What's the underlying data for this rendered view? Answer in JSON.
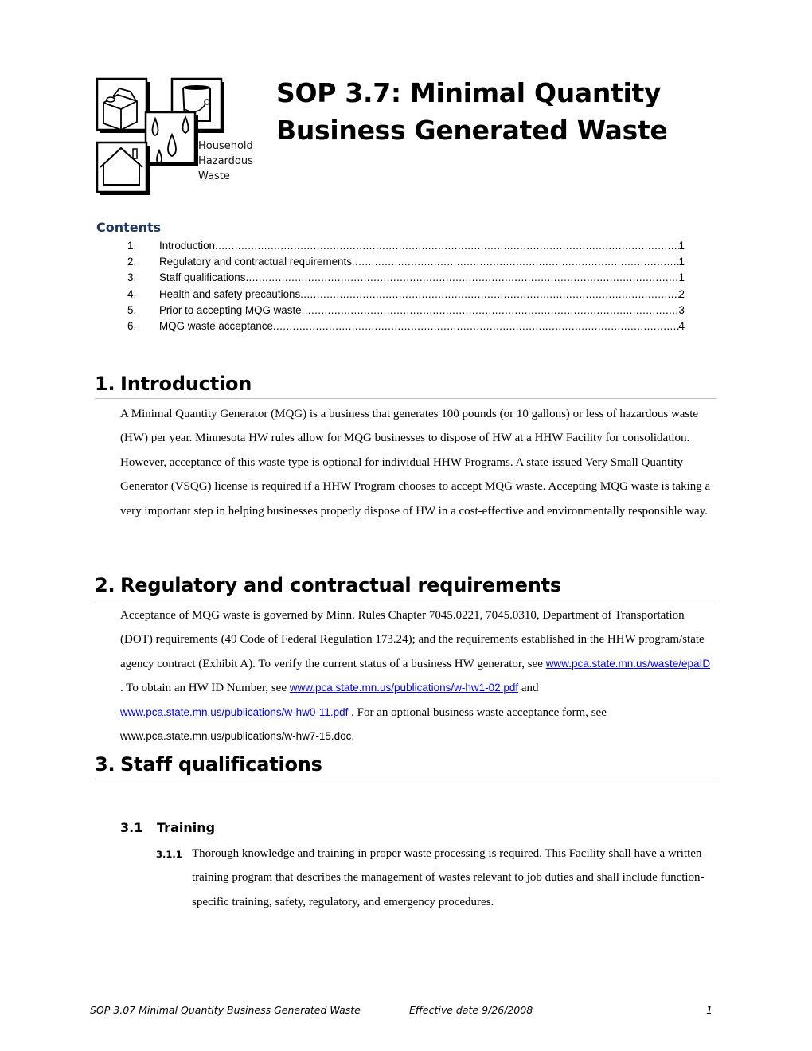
{
  "logo": {
    "caption_lines": [
      "Household",
      "Hazardous",
      "Waste"
    ]
  },
  "title": {
    "line1": "SOP 3.7: Minimal Quantity",
    "line2": "Business Generated Waste"
  },
  "contents": {
    "heading": "Contents",
    "items": [
      {
        "num": "1.",
        "label": "Introduction",
        "page": "1"
      },
      {
        "num": "2.",
        "label": "Regulatory and contractual requirements",
        "page": "1"
      },
      {
        "num": "3.",
        "label": "Staff qualifications",
        "page": "1"
      },
      {
        "num": "4.",
        "label": "Health and safety precautions",
        "page": "2"
      },
      {
        "num": "5.",
        "label": "Prior to accepting MQG waste",
        "page": "3"
      },
      {
        "num": "6.",
        "label": "MQG waste acceptance",
        "page": "4"
      }
    ]
  },
  "sections": {
    "intro": {
      "num": "1.",
      "title": "Introduction",
      "body": "A Minimal Quantity Generator (MQG) is a business that generates 100 pounds (or 10 gallons) or less of hazardous waste (HW) per year. Minnesota HW rules allow for MQG businesses to dispose of HW at a HHW Facility for consolidation. However, acceptance of this waste type is optional for individual HHW Programs. A state-issued Very Small Quantity Generator (VSQG) license is required if a HHW Program chooses to accept MQG waste. Accepting MQG waste is taking a very important step in helping businesses properly dispose of HW in a cost-effective and environmentally responsible way."
    },
    "regulatory": {
      "num": "2.",
      "title": "Regulatory and contractual requirements",
      "text1": "Acceptance of MQG waste is governed by Minn. Rules Chapter 7045.0221, 7045.0310, Department of Transportation (DOT) requirements (49 Code of Federal Regulation 173.24); and the requirements established in the HHW program/state agency contract (Exhibit A). To verify the current status of a business HW generator, see ",
      "link1": "www.pca.state.mn.us/waste/epaID",
      "text2": " . To obtain an HW ID Number, see ",
      "link2": "www.pca.state.mn.us/publications/w-hw1-02.pdf",
      "text3": " and ",
      "link3": "www.pca.state.mn.us/publications/w-hw0-11.pdf",
      "text4": " . For an optional business waste acceptance form, see ",
      "url_plain": "www.pca.state.mn.us/publications/w-hw7-15.doc",
      "text5": "."
    },
    "staff": {
      "num": "3.",
      "title": "Staff qualifications",
      "sub": {
        "num": "3.1",
        "title": "Training",
        "item_num": "3.1.1",
        "item_text": "Thorough knowledge and training in proper waste processing is required. This Facility shall have a written training program that describes the management of wastes relevant to job duties and shall include function-specific training, safety, regulatory, and emergency procedures."
      }
    }
  },
  "footer": {
    "doc_title": "SOP 3.07 Minimal Quantity Business Generated Waste",
    "effective": "Effective date 9/26/2008",
    "page": "1"
  },
  "colors": {
    "contents_heading": "#1f3864",
    "link": "#0000ee",
    "rule": "#c0c0c0"
  }
}
